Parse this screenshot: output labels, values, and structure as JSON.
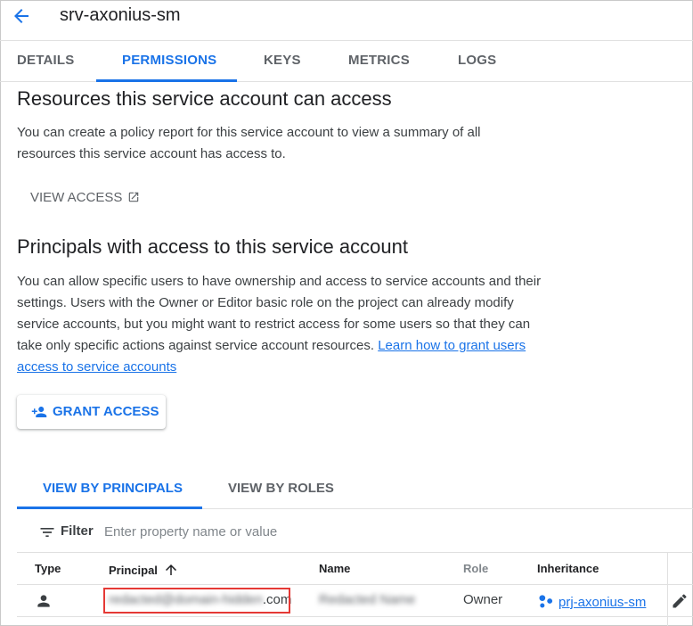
{
  "header": {
    "title": "srv-axonius-sm",
    "back_icon": "arrow-back-icon"
  },
  "tabs": [
    {
      "label": "DETAILS",
      "active": false
    },
    {
      "label": "PERMISSIONS",
      "active": true
    },
    {
      "label": "KEYS",
      "active": false
    },
    {
      "label": "METRICS",
      "active": false
    },
    {
      "label": "LOGS",
      "active": false
    }
  ],
  "resources": {
    "heading": "Resources this service account can access",
    "text_line1": "You can create a policy report for this service account to view a summary of all",
    "text_line2": "resources this service account has access to.",
    "view_access_label": "VIEW ACCESS",
    "view_access_icon": "open-in-new-icon"
  },
  "principals": {
    "heading": "Principals with access to this service account",
    "text_line1": "You can allow specific users to have ownership and access to service accounts and their",
    "text_line2": "settings. Users with the Owner or Editor basic role on the project can already modify",
    "text_line3": "service accounts, but you might want to restrict access for some users so that they can",
    "text_line4_prefix": "take only specific actions against service account resources. ",
    "link_part1": "Learn how to grant users",
    "link_part2": "access to service accounts",
    "grant_label": "GRANT ACCESS",
    "grant_icon": "person-add-icon"
  },
  "view_tabs": [
    {
      "label": "VIEW BY PRINCIPALS",
      "active": true
    },
    {
      "label": "VIEW BY ROLES",
      "active": false
    }
  ],
  "filter": {
    "label": "Filter",
    "placeholder": "Enter property name or value",
    "icon": "filter-list-icon"
  },
  "table": {
    "columns": [
      "Type",
      "Principal",
      "Name",
      "Role",
      "Inheritance"
    ],
    "sort_icon": "arrow-upward-icon",
    "rows": [
      {
        "type_icon": "person-icon",
        "principal_blurred": "redacted@domain-hidden",
        "principal_suffix": ".com",
        "name_blurred": "Redacted Name",
        "role": "Owner",
        "inheritance": "prj-axonius-sm",
        "inheritance_icon": "project-icon",
        "edit_icon": "pencil-icon"
      }
    ]
  },
  "colors": {
    "accent": "#1a73e8",
    "highlight": "#e53935"
  }
}
